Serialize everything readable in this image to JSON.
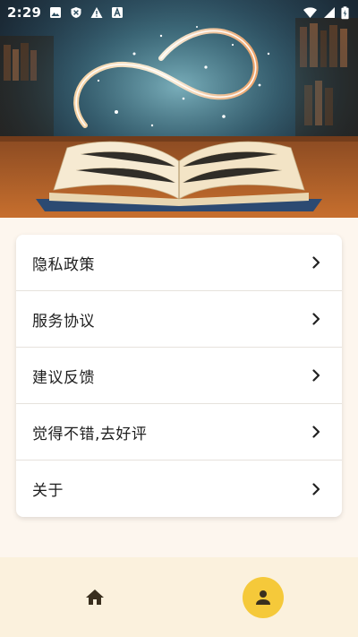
{
  "status_bar": {
    "time": "2:29",
    "left_icons": [
      "image-icon",
      "shield-icon",
      "alert-icon",
      "font-icon"
    ],
    "right_icons": [
      "wifi-icon",
      "signal-icon",
      "battery-icon"
    ]
  },
  "hero": {
    "icon": "open-book-illustration"
  },
  "menu": {
    "items": [
      {
        "label": "隐私政策",
        "icon": "chevron-right-icon"
      },
      {
        "label": "服务协议",
        "icon": "chevron-right-icon"
      },
      {
        "label": "建议反馈",
        "icon": "chevron-right-icon"
      },
      {
        "label": "觉得不错,去好评",
        "icon": "chevron-right-icon"
      },
      {
        "label": "关于",
        "icon": "chevron-right-icon"
      }
    ]
  },
  "bottom_nav": {
    "items": [
      {
        "icon": "home-icon",
        "active": false
      },
      {
        "icon": "person-icon",
        "active": true
      }
    ],
    "active_color": "#f5c93a",
    "background": "#fbf1dd"
  },
  "colors": {
    "page_background": "#fdf6ee",
    "card_background": "#ffffff",
    "icon_color": "#3a2f1e"
  }
}
